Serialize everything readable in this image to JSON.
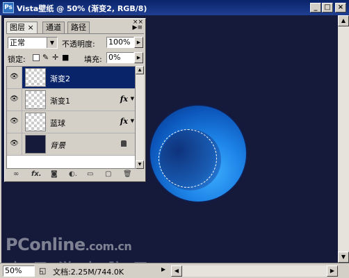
{
  "window": {
    "app_icon": "Ps",
    "title": "Vista壁纸 @ 50% (渐变2, RGB/8)",
    "controls": [
      "_",
      "□",
      "×"
    ]
  },
  "layers_panel": {
    "tabs": [
      "图层 ×",
      "通道",
      "路径"
    ],
    "blend_mode": "正常",
    "opacity_label": "不透明度:",
    "opacity_value": "100%",
    "lock_label": "锁定:",
    "fill_label": "填充:",
    "fill_value": "0%",
    "layers": [
      {
        "name": "渐变2",
        "selected": true,
        "fx": "",
        "visible": true
      },
      {
        "name": "渐变1",
        "selected": false,
        "fx": "fx",
        "visible": true
      },
      {
        "name": "蓝球",
        "selected": false,
        "fx": "fx",
        "visible": true
      },
      {
        "name": "背景",
        "selected": false,
        "fx": "",
        "visible": true,
        "locked": true
      }
    ],
    "bottom_icons": [
      "link-icon",
      "fx-icon",
      "mask-icon",
      "adjustment-icon",
      "folder-icon",
      "new-layer-icon",
      "trash-icon"
    ]
  },
  "canvas": {
    "background": "#151a3a",
    "watermark_line1": "PConline",
    "watermark_domain": ".com.cn",
    "watermark_line2": "太平洋电脑网"
  },
  "status": {
    "zoom": "50%",
    "doc_info": "文档:2.25M/744.0K"
  },
  "colors": {
    "title_bar": "#0a246a",
    "selected_layer": "#0a246a",
    "sphere_blue": "#1e85e8"
  }
}
